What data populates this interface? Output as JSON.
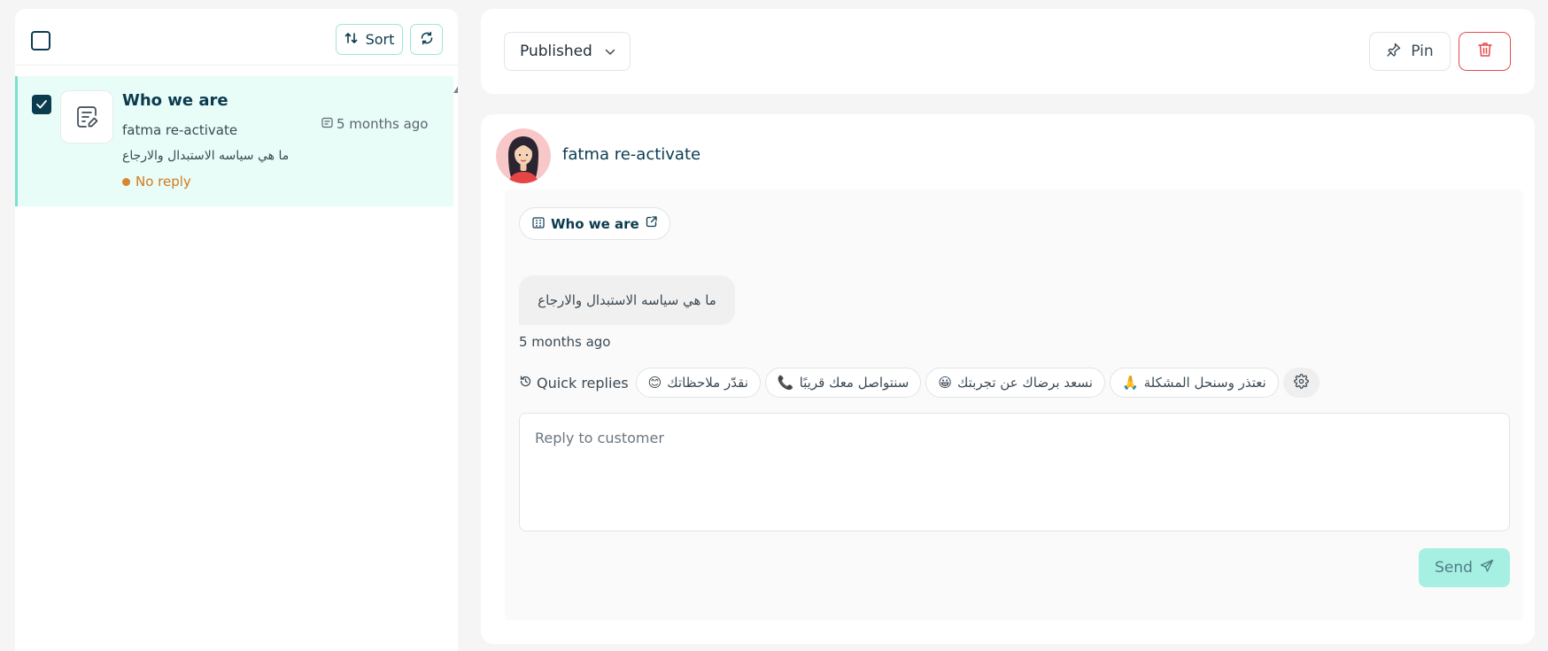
{
  "list": {
    "sort_label": "Sort",
    "items": [
      {
        "title": "Who we are",
        "customer": "fatma re-activate",
        "message": "ما هي سياسه الاستبدال والارجاع",
        "time": "5 months ago",
        "status": "No reply",
        "checked": true
      }
    ]
  },
  "toolbar": {
    "status_value": "Published",
    "pin_label": "Pin"
  },
  "chat": {
    "customer_name": "fatma re-activate",
    "article_chip": "Who we are",
    "message_text": "ما هي سياسه الاستبدال والارجاع",
    "message_time": "5 months ago",
    "quick_replies_label": "Quick replies",
    "quick_replies": [
      {
        "text": "نقدّر ملاحظاتك",
        "icon": "😊"
      },
      {
        "text": "سنتواصل معك قريبًا",
        "icon": "📞"
      },
      {
        "text": "نسعد برضاك عن تجربتك",
        "icon": "😀"
      },
      {
        "text": "نعتذر وسنحل المشكلة",
        "icon": "🙏"
      }
    ],
    "reply_placeholder": "Reply to customer",
    "send_label": "Send"
  },
  "colors": {
    "brand_dark": "#0b3b4f",
    "accent_mint": "#a6f0e3",
    "status_orange": "#d27a1b",
    "danger": "#e5484d"
  },
  "icons": {
    "sort": "sort-arrows-icon",
    "refresh": "refresh-icon",
    "article": "article-edit-icon",
    "time": "calendar-icon",
    "dropdown": "chevron-down-icon",
    "pin": "pin-icon",
    "delete": "trash-icon",
    "chip": "building-icon",
    "external": "external-link-icon",
    "quick": "history-icon",
    "settings": "gear-icon",
    "send": "send-icon"
  }
}
